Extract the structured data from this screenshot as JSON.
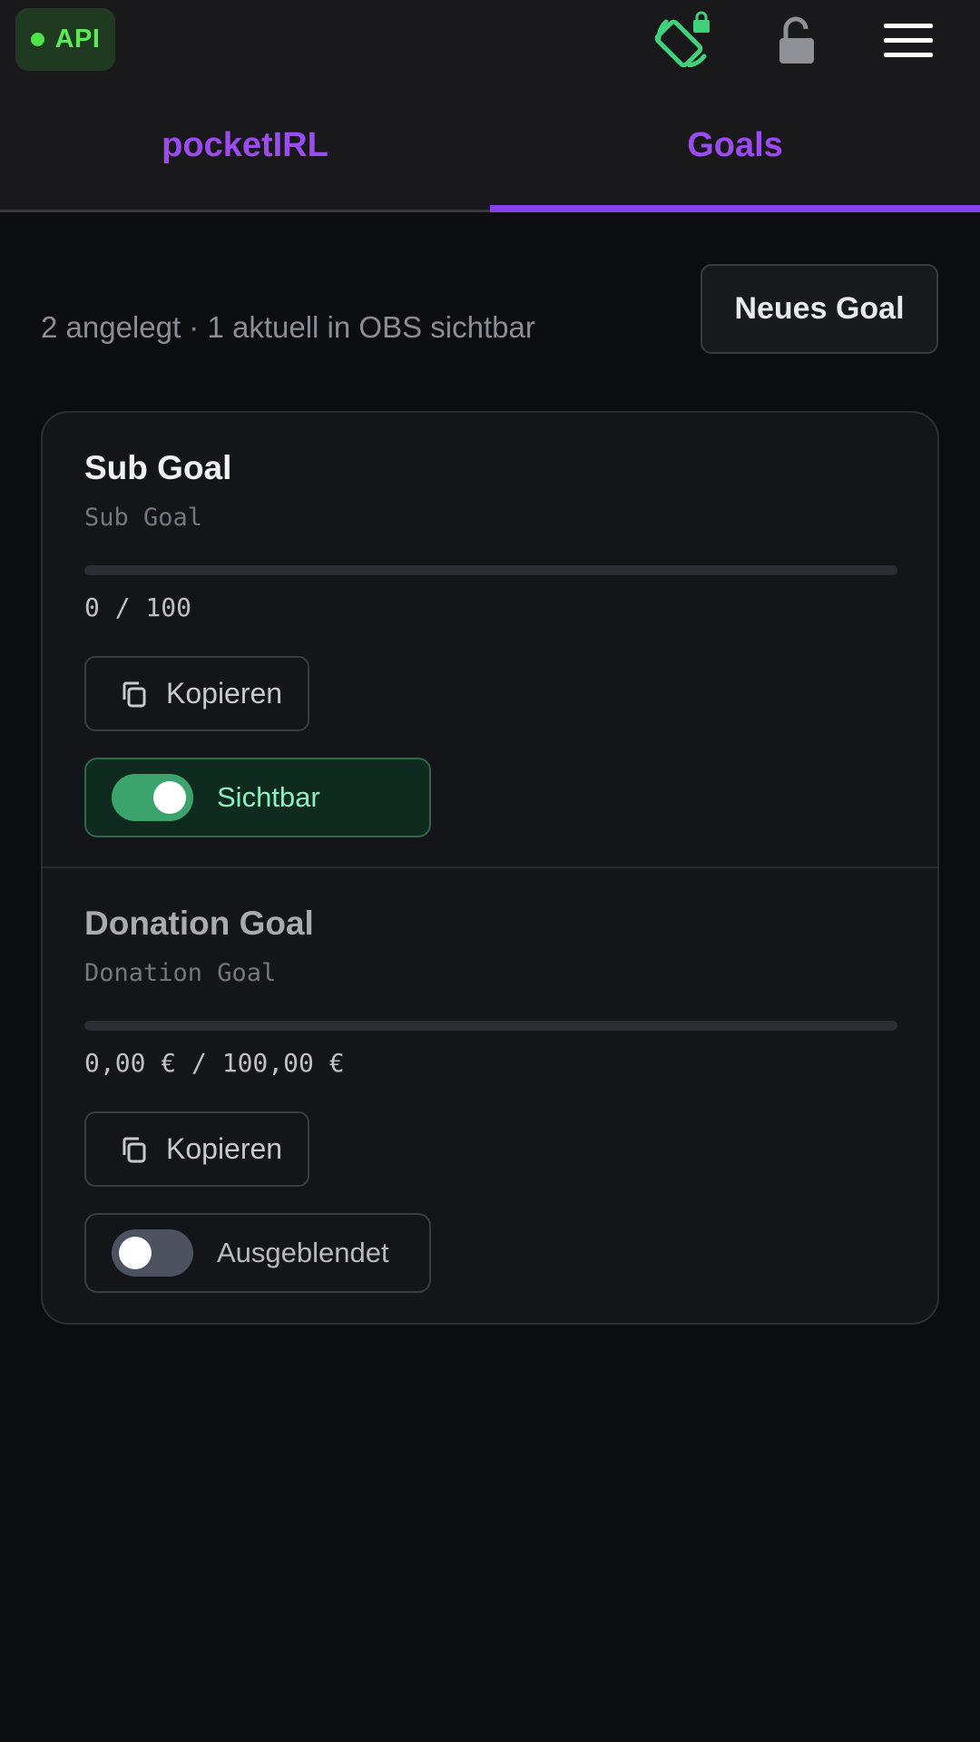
{
  "header": {
    "api_label": "API",
    "api_status_color": "#4ee14a",
    "icons": [
      "screen-rotation-lock-icon",
      "unlock-icon",
      "hamburger-menu-icon"
    ]
  },
  "tabs": [
    {
      "label": "pocketIRL",
      "active": false
    },
    {
      "label": "Goals",
      "active": true
    }
  ],
  "summary": "2 angelegt · 1 aktuell in OBS sichtbar",
  "new_goal_label": "Neues Goal",
  "goals": [
    {
      "title": "Sub Goal",
      "subtitle": "Sub Goal",
      "amount": "0 / 100",
      "progress": 0,
      "copy_label": "Kopieren",
      "visible": true,
      "toggle_label": "Sichtbar"
    },
    {
      "title": "Donation Goal",
      "subtitle": "Donation Goal",
      "amount": "0,00 € / 100,00 €",
      "progress": 0,
      "copy_label": "Kopieren",
      "visible": false,
      "toggle_label": "Ausgeblendet"
    }
  ],
  "colors": {
    "accent": "#8b3df0",
    "tab_text": "#9a4cf0",
    "api_green": "#5ee857",
    "toggle_on": "#3ba46d"
  }
}
